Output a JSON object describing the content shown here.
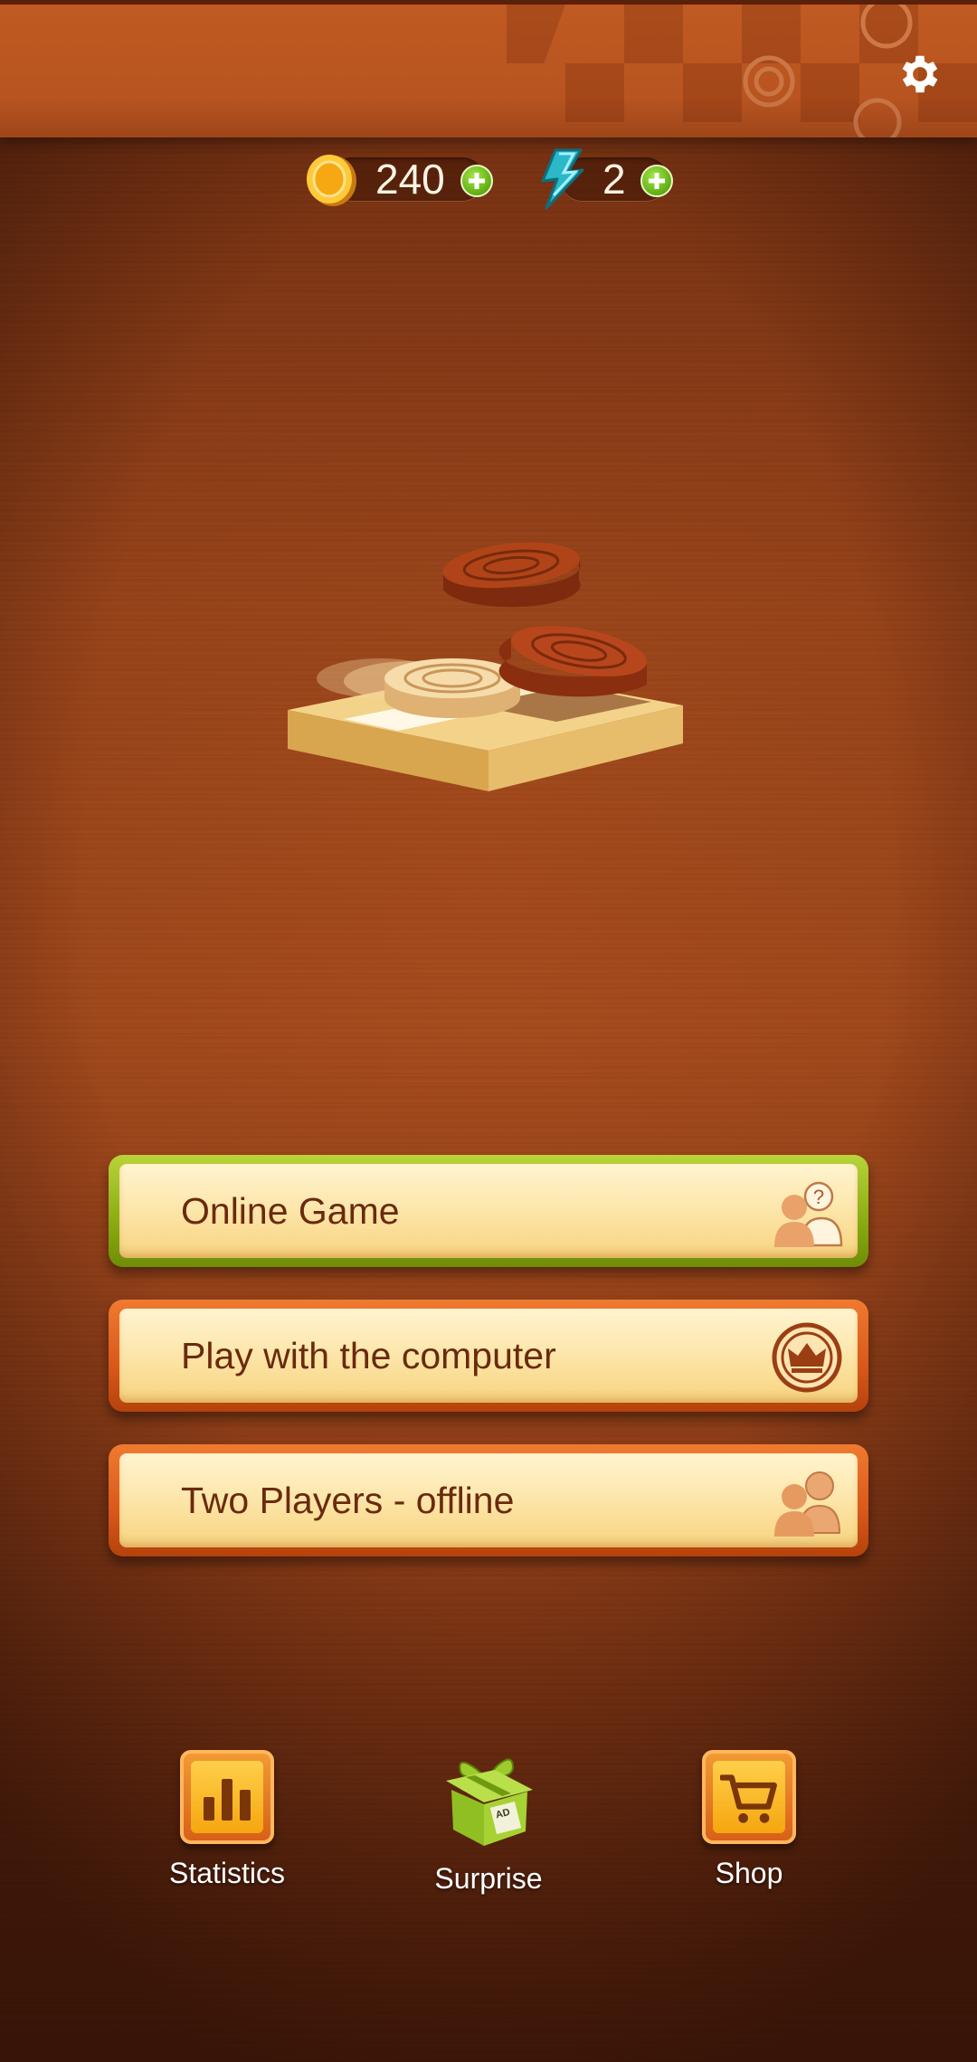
{
  "header": {
    "settings_icon": "gear-icon"
  },
  "currency": {
    "coins": {
      "icon": "coin-icon",
      "value": "240"
    },
    "energy": {
      "icon": "lightning-icon",
      "value": "2"
    }
  },
  "menu": {
    "online": {
      "label": "Online Game",
      "icon": "players-question-icon",
      "accent": "#8aab12"
    },
    "computer": {
      "label": "Play with the computer",
      "icon": "crown-icon",
      "accent": "#d8581a"
    },
    "two_players": {
      "label": "Two Players - offline",
      "icon": "two-players-icon",
      "accent": "#d8581a"
    }
  },
  "bottom": {
    "statistics": {
      "label": "Statistics",
      "icon": "bar-chart-icon"
    },
    "surprise": {
      "label": "Surprise",
      "icon": "gift-icon",
      "badge": "AD"
    },
    "shop": {
      "label": "Shop",
      "icon": "cart-icon"
    }
  },
  "colors": {
    "wood": "#a84b1c",
    "button_face": "#fde7ad",
    "label": "#6a2a0e",
    "plus": "#5fae12"
  }
}
